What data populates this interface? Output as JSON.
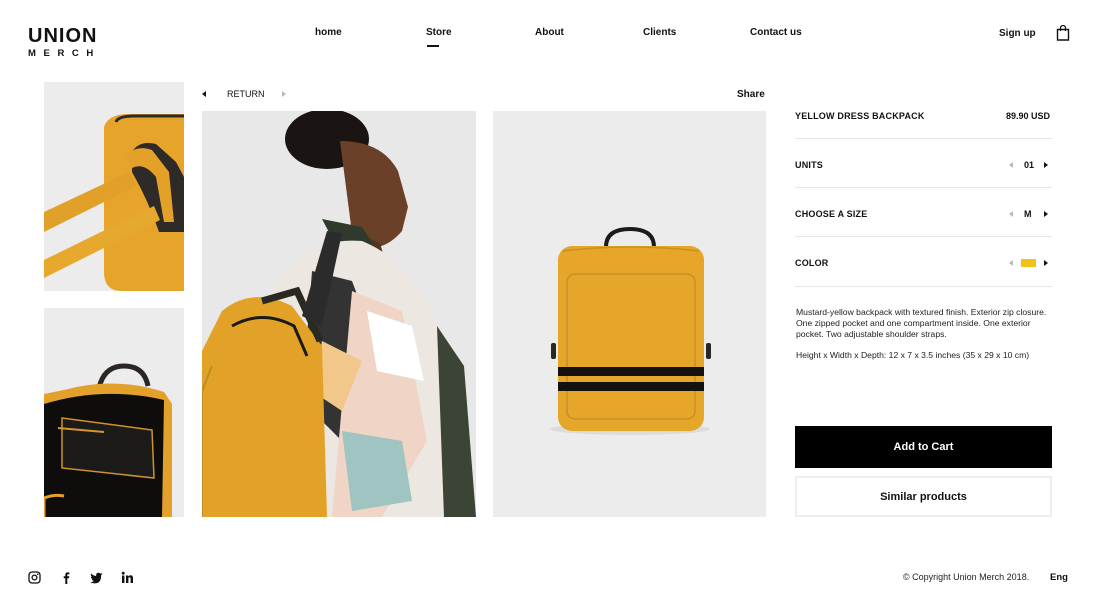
{
  "brand": {
    "line1": "UNION",
    "line2": "MERCH"
  },
  "nav": {
    "items": [
      {
        "label": "home"
      },
      {
        "label": "Store",
        "active": true
      },
      {
        "label": "About"
      },
      {
        "label": "Clients"
      },
      {
        "label": "Contact us"
      }
    ],
    "signup": "Sign up",
    "cart_icon": "shopping-bag-icon"
  },
  "breadcrumb": {
    "return_label": "RETURN",
    "share_label": "Share"
  },
  "product": {
    "name": "YELLOW DRESS BACKPACK",
    "price": "89.90 USD",
    "options": [
      {
        "label": "UNITS",
        "value": "01"
      },
      {
        "label": "CHOOSE A SIZE",
        "value": "M"
      },
      {
        "label": "COLOR",
        "swatch": "#f2c21b"
      }
    ],
    "description": "Mustard-yellow backpack with textured finish. Exterior zip closure. One zipped pocket and one compartment inside. One exterior pocket. Two adjustable shoulder straps.",
    "dimensions": "Height x Width x Depth: 12 x 7 x 3.5 inches (35 x 29 x 10 cm)",
    "add_to_cart": "Add to Cart",
    "similar": "Similar products"
  },
  "colors": {
    "accent_yellow": "#e9a82a",
    "text": "#111111",
    "button_bg": "#000000"
  },
  "footer": {
    "social": [
      "instagram-icon",
      "facebook-icon",
      "twitter-icon",
      "linkedin-icon"
    ],
    "copyright": "© Copyright Union Merch 2018.",
    "lang": "Eng"
  }
}
